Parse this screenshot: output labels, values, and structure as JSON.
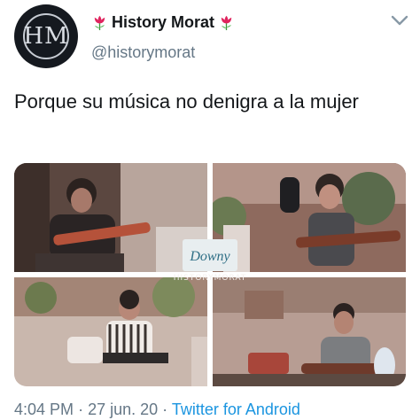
{
  "tweet": {
    "avatar_text": "HM",
    "display_name": "History Morat",
    "handle": "@historymorat",
    "text": "Porque su música no denigra a la mujer",
    "timestamp_time": "4:04 PM",
    "separator": "·",
    "timestamp_date": "27 jun. 20",
    "source": "Twitter for Android",
    "name_emoji": "tulip-icon",
    "menu_icon": "chevron-down-icon"
  },
  "media": {
    "brand_label": "Downy",
    "watermark": "HISTORYMORAT",
    "tile_count": 4
  },
  "colors": {
    "text": "#14171a",
    "secondary": "#657786",
    "link": "#1b95e0",
    "avatar_bg": "#15191f",
    "tulip": "#e0245e"
  }
}
